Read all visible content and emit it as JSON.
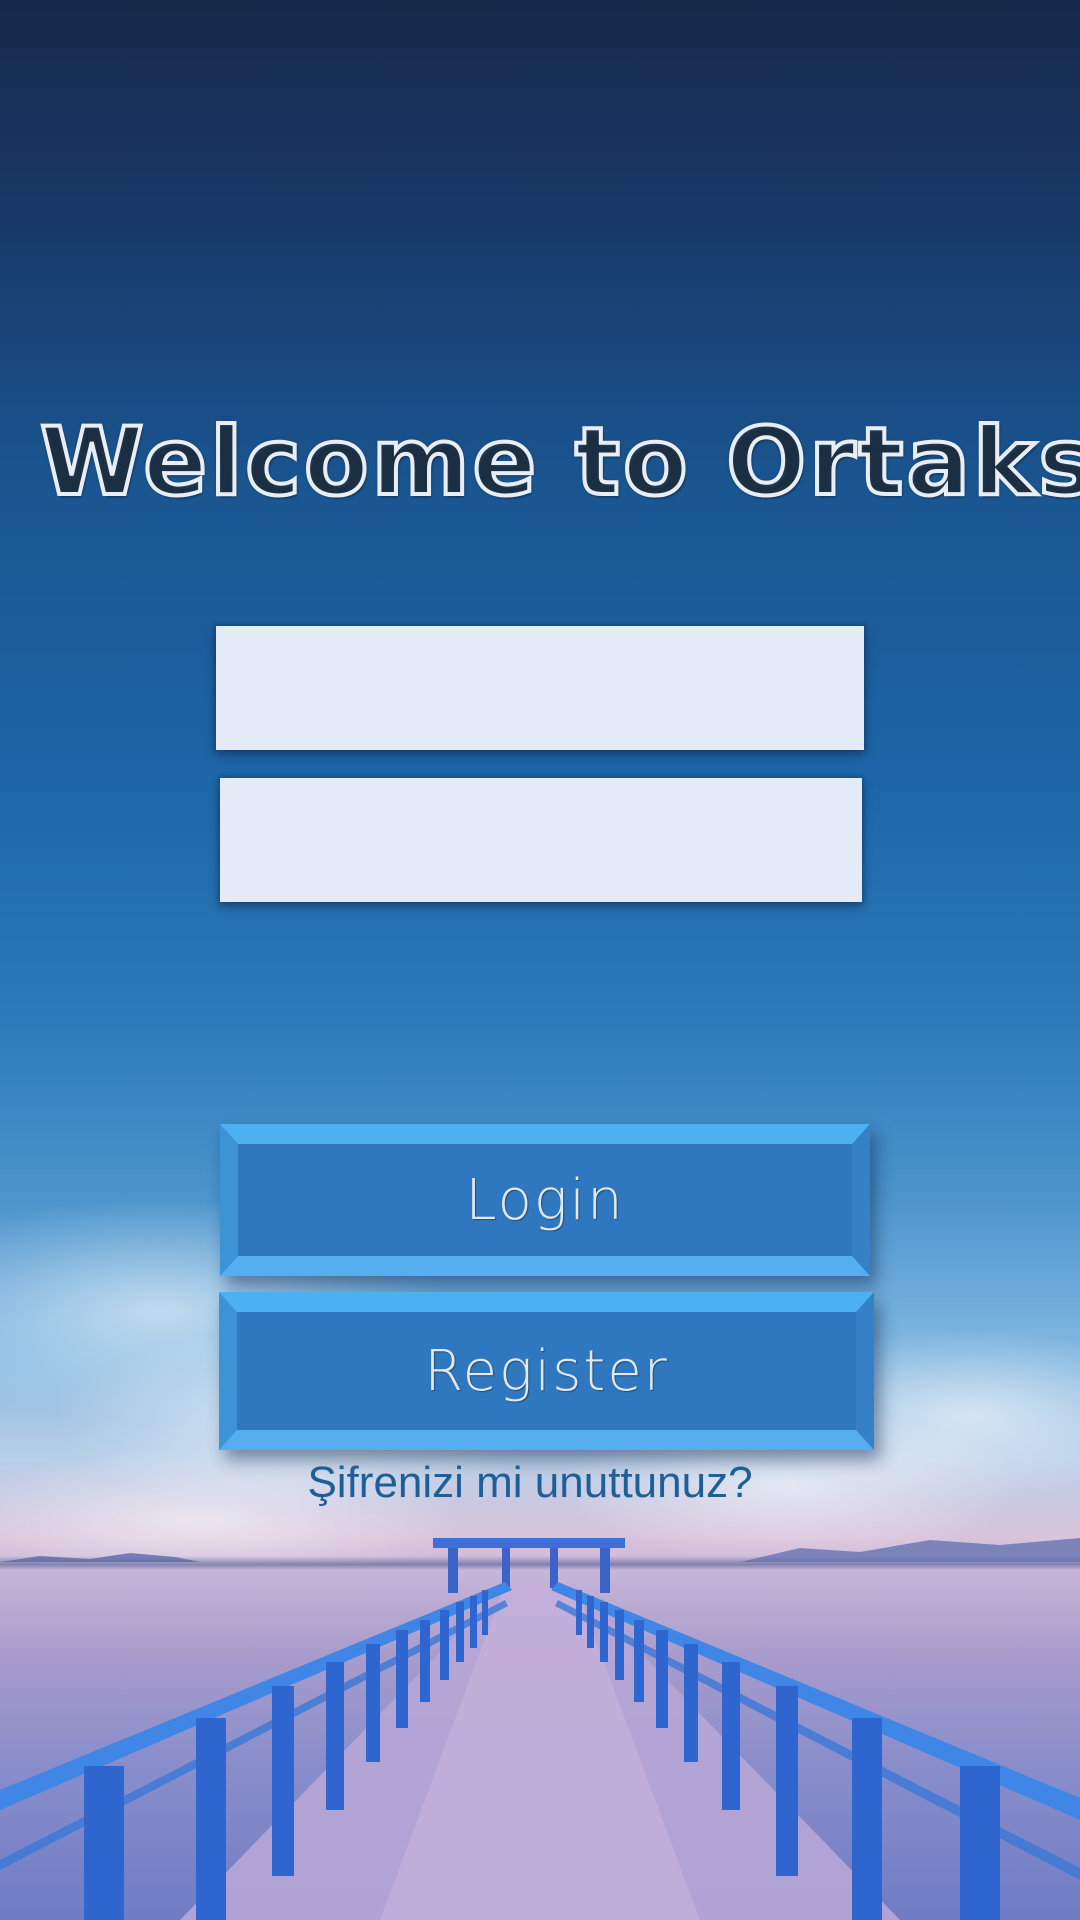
{
  "app": {
    "welcome_title": "Welcome to Ortaksi"
  },
  "login_form": {
    "username_value": "",
    "password_value": "",
    "login_label": "Login",
    "register_label": "Register",
    "forgot_password_label": "Şifrenizi mi unuttunuz?"
  },
  "background": {
    "scene": "pier-at-sunset",
    "sky_top_color": "#17284a",
    "sky_mid_color": "#1d65a6",
    "horizon_color": "#d9c4dc",
    "pier_color": "#3f7fe0"
  },
  "colors": {
    "field_background": "#e3ebf6",
    "button_face": "#2f78bf",
    "button_bevel": "#4db0f0",
    "link_text": "#1d5f97"
  }
}
